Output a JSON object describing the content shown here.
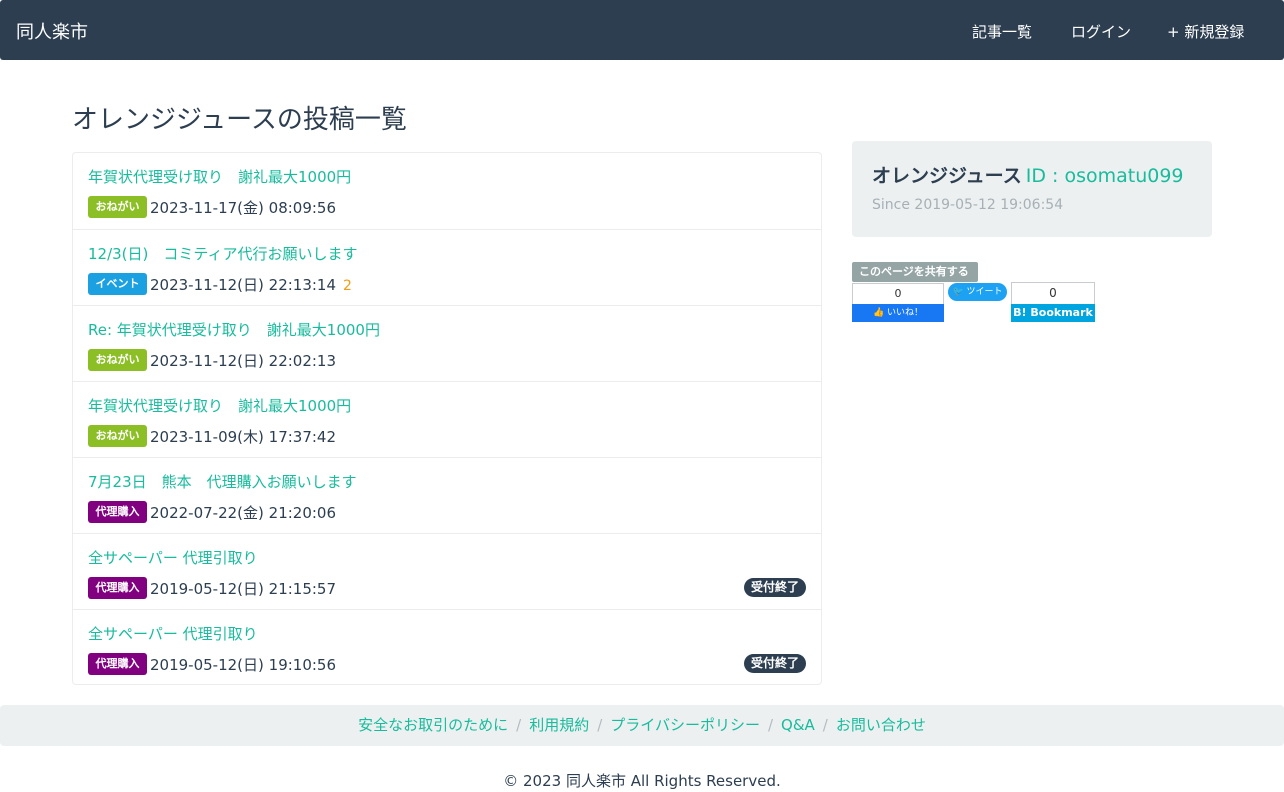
{
  "navbar": {
    "brand": "同人楽市",
    "links": [
      {
        "icon": "",
        "label": "記事一覧"
      },
      {
        "icon": "",
        "label": "ログイン"
      },
      {
        "icon": "+",
        "label": "新規登録"
      }
    ]
  },
  "page": {
    "title": "オレンジジュースの投稿一覧"
  },
  "posts": [
    {
      "title": "年賀状代理受け取り　謝礼最大1000円",
      "category": "おねがい",
      "category_color": "#8cbf26",
      "date": "2023-11-17(金) 08:09:56",
      "comment_icon": "",
      "comment_count": "",
      "status": ""
    },
    {
      "title": "12/3(日)　コミティア代行お願いします",
      "category": "イベント",
      "category_color": "#1ba1e2",
      "date": "2023-11-12(日) 22:13:14",
      "comment_icon": "",
      "comment_count": "2",
      "status": ""
    },
    {
      "title": "Re: 年賀状代理受け取り　謝礼最大1000円",
      "category": "おねがい",
      "category_color": "#8cbf26",
      "date": "2023-11-12(日) 22:02:13",
      "comment_icon": "",
      "comment_count": "",
      "status": ""
    },
    {
      "title": "年賀状代理受け取り　謝礼最大1000円",
      "category": "おねがい",
      "category_color": "#8cbf26",
      "date": "2023-11-09(木) 17:37:42",
      "comment_icon": "",
      "comment_count": "",
      "status": ""
    },
    {
      "title": "7月23日　熊本　代理購入お願いします",
      "category": "代理購入",
      "category_color": "#800080",
      "date": "2022-07-22(金) 21:20:06",
      "comment_icon": "",
      "comment_count": "",
      "status": ""
    },
    {
      "title": "全サペーパー 代理引取り",
      "category": "代理購入",
      "category_color": "#800080",
      "date": "2019-05-12(日) 21:15:57",
      "comment_icon": "",
      "comment_count": "",
      "status": "受付終了"
    },
    {
      "title": "全サペーパー 代理引取り",
      "category": "代理購入",
      "category_color": "#800080",
      "date": "2019-05-12(日) 19:10:56",
      "comment_icon": "",
      "comment_count": "",
      "status": "受付終了"
    }
  ],
  "profile": {
    "icon": "",
    "name": "オレンジジュース",
    "id_text": "ID : osomatu099",
    "since_icon": "",
    "since": "Since 2019-05-12 19:06:54"
  },
  "share": {
    "label": "このページを共有する",
    "facebook": {
      "count": "0",
      "label": "いいね！"
    },
    "twitter": {
      "label": "ツイート"
    },
    "hatena": {
      "count": "0",
      "label": "B! Bookmark"
    }
  },
  "footer": {
    "links": [
      "安全なお取引のために",
      "利用規約",
      "プライバシーポリシー",
      "Q&A",
      "お問い合わせ"
    ],
    "copyright": "© 2023 同人楽市 All Rights Reserved."
  }
}
